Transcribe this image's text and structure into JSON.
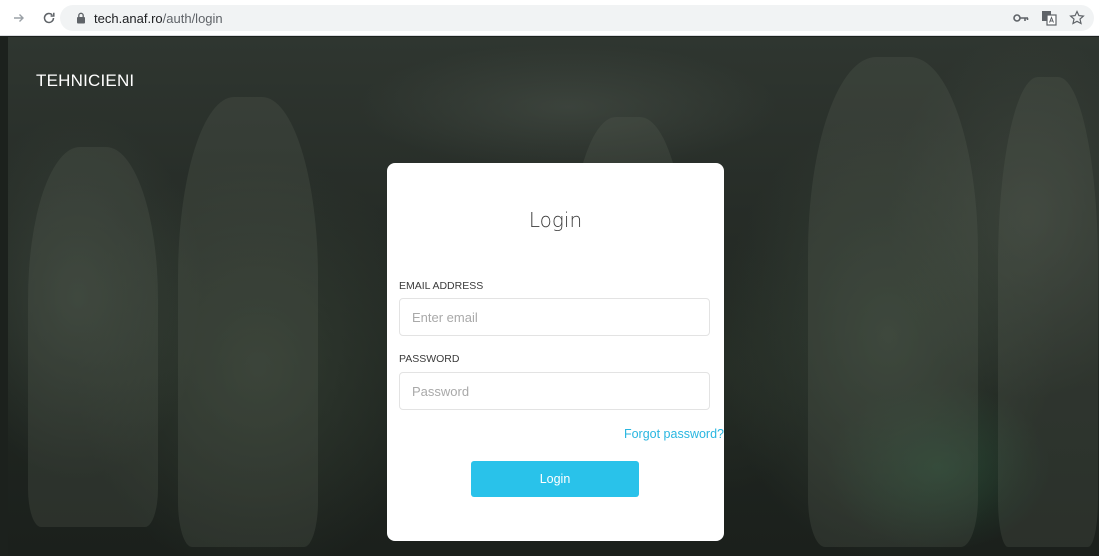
{
  "browser": {
    "url_host": "tech.anaf.ro",
    "url_path": "/auth/login",
    "icons": [
      "back-arrow-icon",
      "reload-icon",
      "lock-icon",
      "key-icon",
      "translate-icon",
      "star-icon"
    ]
  },
  "page": {
    "brand": "TEHNICIENI"
  },
  "login": {
    "title": "Login",
    "email_label": "EMAIL ADDRESS",
    "email_placeholder": "Enter email",
    "email_value": "",
    "password_label": "PASSWORD",
    "password_placeholder": "Password",
    "password_value": "",
    "forgot_label": "Forgot password?",
    "submit_label": "Login"
  },
  "colors": {
    "accent": "#29c2ea",
    "link": "#29b6e0",
    "card_bg": "#ffffff"
  }
}
